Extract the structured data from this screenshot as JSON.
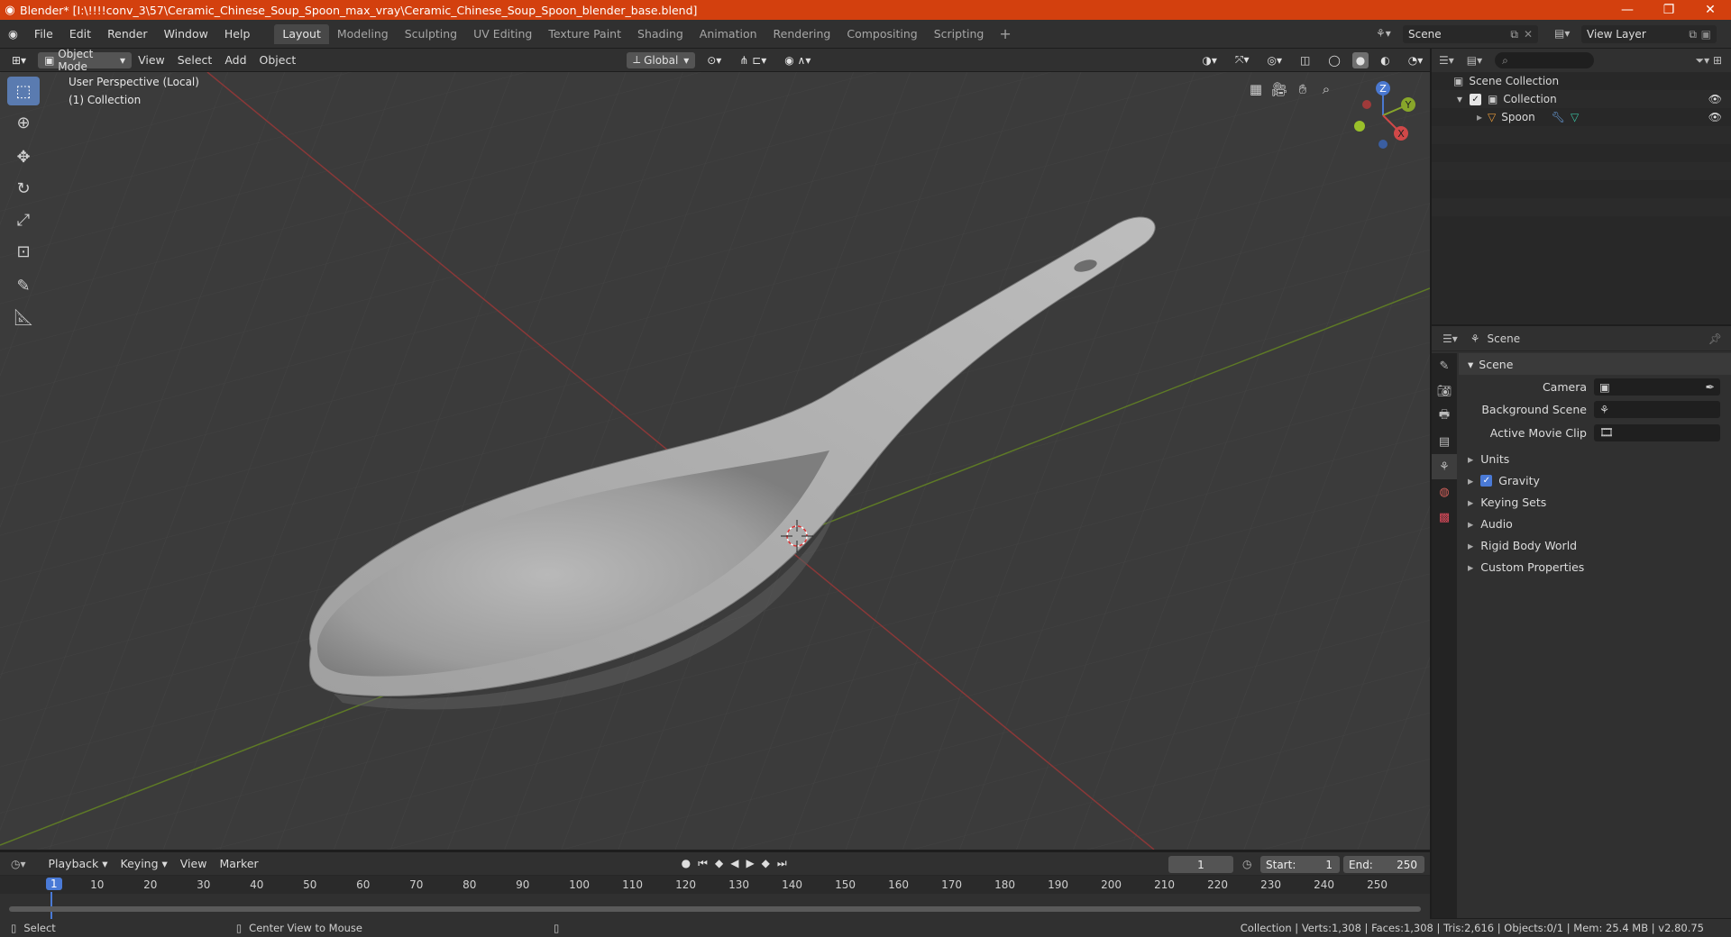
{
  "window": {
    "title": "Blender* [I:\\!!!!conv_3\\57\\Ceramic_Chinese_Soup_Spoon_max_vray\\Ceramic_Chinese_Soup_Spoon_blender_base.blend]",
    "minimize": "—",
    "maximize": "❐",
    "close": "✕"
  },
  "menu": [
    "File",
    "Edit",
    "Render",
    "Window",
    "Help"
  ],
  "workspaces": [
    "Layout",
    "Modeling",
    "Sculpting",
    "UV Editing",
    "Texture Paint",
    "Shading",
    "Animation",
    "Rendering",
    "Compositing",
    "Scripting"
  ],
  "scene_selector": "Scene",
  "view_layer": "View Layer",
  "viewport_header": {
    "mode": "Object Mode",
    "menus": [
      "View",
      "Select",
      "Add",
      "Object"
    ],
    "orientation": "Global"
  },
  "overlay": {
    "perspective": "User Perspective (Local)",
    "collection": "(1) Collection"
  },
  "gizmo": {
    "z": "Z",
    "y": "Y",
    "x": "X"
  },
  "outliner": {
    "root": "Scene Collection",
    "collection": "Collection",
    "object": "Spoon"
  },
  "properties": {
    "header": "Scene",
    "panel": "Scene",
    "camera_label": "Camera",
    "background_label": "Background Scene",
    "clip_label": "Active Movie Clip",
    "sections": [
      "Units",
      "Gravity",
      "Keying Sets",
      "Audio",
      "Rigid Body World",
      "Custom Properties"
    ]
  },
  "timeline": {
    "menus": [
      "Playback",
      "Keying",
      "View",
      "Marker"
    ],
    "current_frame": "1",
    "start_label": "Start:",
    "start": "1",
    "end_label": "End:",
    "end": "250",
    "ticks": [
      "1",
      "10",
      "20",
      "30",
      "40",
      "50",
      "60",
      "70",
      "80",
      "90",
      "100",
      "110",
      "120",
      "130",
      "140",
      "150",
      "160",
      "170",
      "180",
      "190",
      "200",
      "210",
      "220",
      "230",
      "240",
      "250"
    ]
  },
  "status": {
    "left": "Select",
    "middle": "Center View to Mouse",
    "right": "Collection | Verts:1,308 | Faces:1,308 | Tris:2,616 | Objects:0/1 | Mem: 25.4 MB | v2.80.75"
  },
  "colors": {
    "titlebar": "#d3400e",
    "accent": "#4a7ad6",
    "x_axis": "#c84c4c",
    "y_axis": "#7a9a2a"
  }
}
